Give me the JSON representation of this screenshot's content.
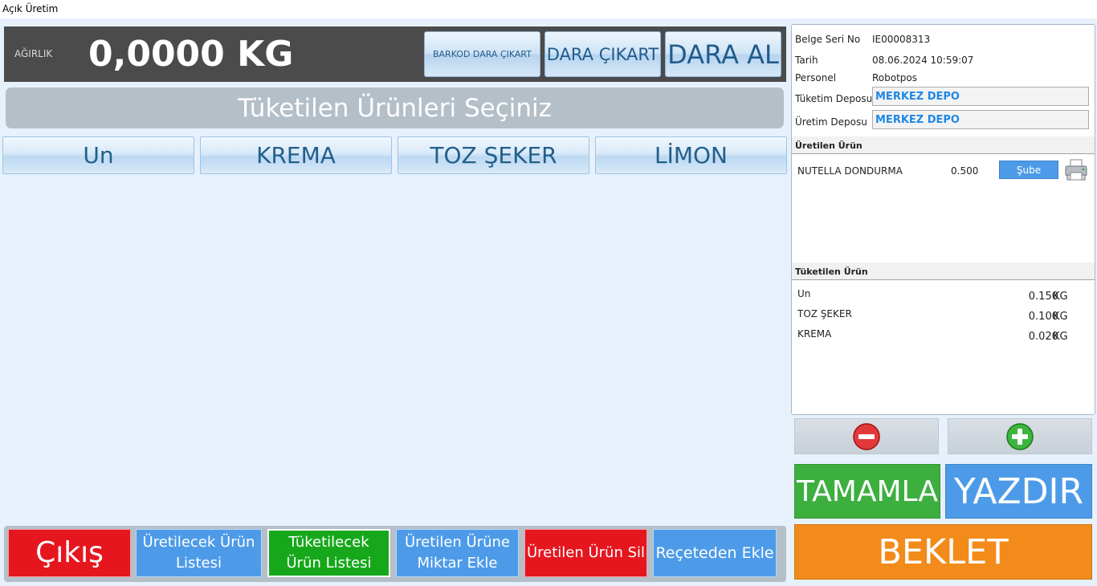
{
  "window": {
    "title": "Açık Üretim"
  },
  "weight": {
    "label": "AĞIRLIK",
    "value": "0,0000 KG"
  },
  "tare_buttons": {
    "barcode": "BARKOD DARA ÇIKART",
    "remove": "DARA ÇIKART",
    "take": "DARA AL"
  },
  "section_title": "Tüketilen Ürünleri Seçiniz",
  "products": [
    "Un",
    "KREMA",
    "TOZ ŞEKER",
    "LİMON"
  ],
  "bottom": {
    "exit": "Çıkış",
    "produce_list": "Üretilecek Ürün Listesi",
    "consume_list": "Tüketilecek Ürün Listesi",
    "add_qty": "Üretilen Ürüne Miktar Ekle",
    "delete": "Üretilen Ürün Sil",
    "from_recipe": "Reçeteden Ekle"
  },
  "info": {
    "doc_label": "Belge Seri No",
    "doc_value": "IE00008313",
    "date_label": "Tarih",
    "date_value": "08.06.2024 10:59:07",
    "staff_label": "Personel",
    "staff_value": "Robotpos",
    "consume_depot_label": "Tüketim Deposu",
    "consume_depot_value": "MERKEZ DEPO",
    "produce_depot_label": "Üretim Deposu",
    "produce_depot_value": "MERKEZ DEPO"
  },
  "produced": {
    "header": "Üretilen Ürün",
    "items": [
      {
        "name": "NUTELLA DONDURMA",
        "qty": "0.500",
        "branch_button": "Şube"
      }
    ]
  },
  "consumed": {
    "header": "Tüketilen Ürün",
    "items": [
      {
        "name": "Un",
        "qty": "0.150",
        "unit": "KG"
      },
      {
        "name": "TOZ ŞEKER",
        "qty": "0.100",
        "unit": "KG"
      },
      {
        "name": "KREMA",
        "qty": "0.020",
        "unit": "KG"
      }
    ]
  },
  "actions": {
    "complete": "TAMAMLA",
    "print": "YAZDIR",
    "hold": "BEKLET"
  },
  "colors": {
    "red": "#e6161e",
    "blue": "#4d9be8",
    "green": "#16a81a",
    "orange": "#f28b1a"
  }
}
